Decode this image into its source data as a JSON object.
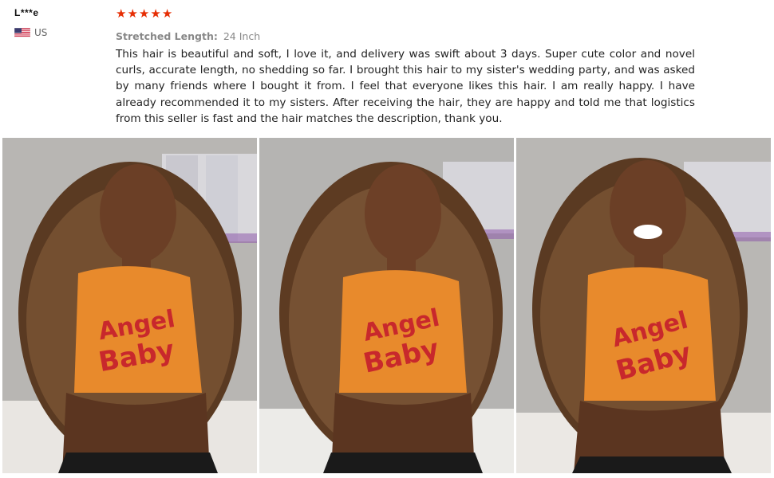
{
  "reviewer": {
    "name": "L***e",
    "country": "US",
    "flag_icon": "us-flag-icon"
  },
  "review": {
    "rating": 5,
    "rating_max": 5,
    "star_color": "#e62e04",
    "sku_label": "Stretched Length:",
    "sku_value": "24 Inch",
    "text": "This hair is beautiful and soft, I love it, and delivery was swift about 3 days. Super cute color and novel curls, accurate length, no shedding so far. I brought this hair to my sister's wedding party, and was asked by many friends where I bought it from. I feel that everyone likes this hair. I am really happy. I have already recommended it to my sisters. After receiving the hair, they are happy and told me that logistics from this seller is fast and the hair matches the description, thank you."
  },
  "photos": [
    {
      "shirt_text_line1": "Angel",
      "shirt_text_line2": "Baby"
    },
    {
      "shirt_text_line1": "Angel",
      "shirt_text_line2": "Baby"
    },
    {
      "shirt_text_line1": "Angel",
      "shirt_text_line2": "Baby"
    }
  ]
}
